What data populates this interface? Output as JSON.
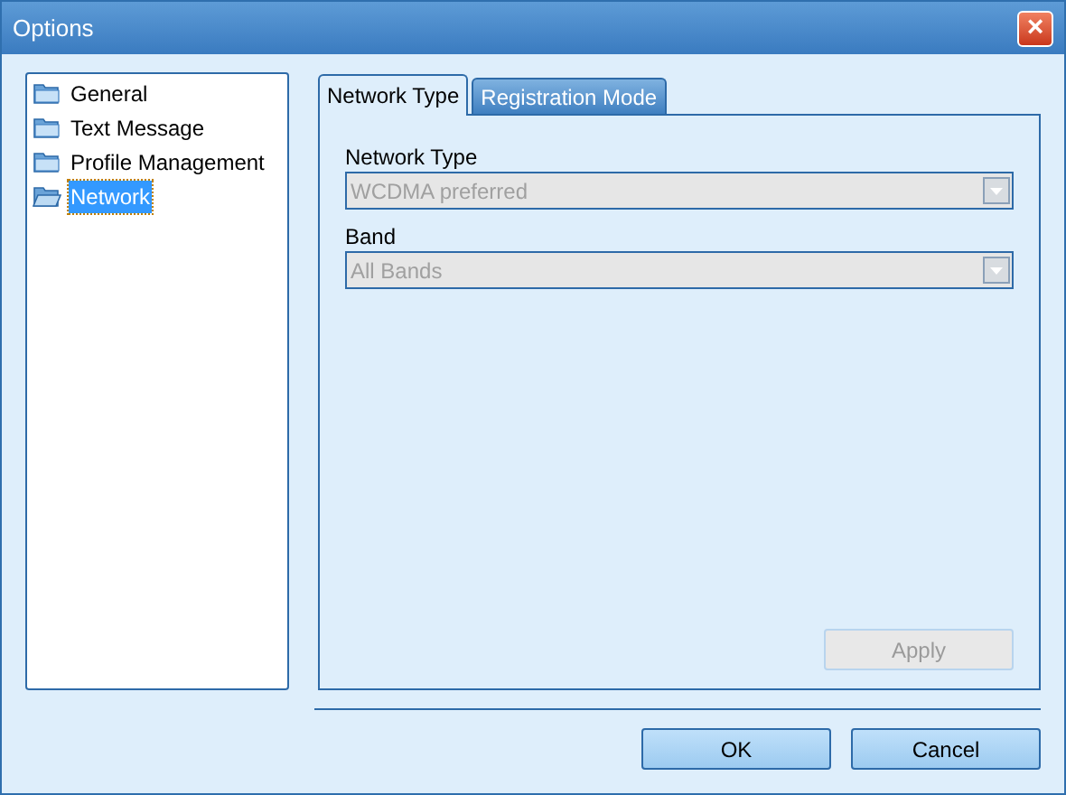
{
  "window": {
    "title": "Options",
    "close": "×"
  },
  "sidebar": {
    "items": [
      {
        "label": "General",
        "selected": false
      },
      {
        "label": "Text Message",
        "selected": false
      },
      {
        "label": "Profile Management",
        "selected": false
      },
      {
        "label": "Network",
        "selected": true
      }
    ]
  },
  "tabs": [
    {
      "label": "Network Type",
      "selected": true
    },
    {
      "label": "Registration Mode",
      "selected": false
    }
  ],
  "fields": [
    {
      "label": "Network Type",
      "value": "WCDMA preferred",
      "disabled": true
    },
    {
      "label": "Band",
      "value": "All Bands",
      "disabled": true
    }
  ],
  "apply": {
    "label": "Apply",
    "disabled": true
  },
  "buttons": [
    "OK",
    "Cancel"
  ]
}
